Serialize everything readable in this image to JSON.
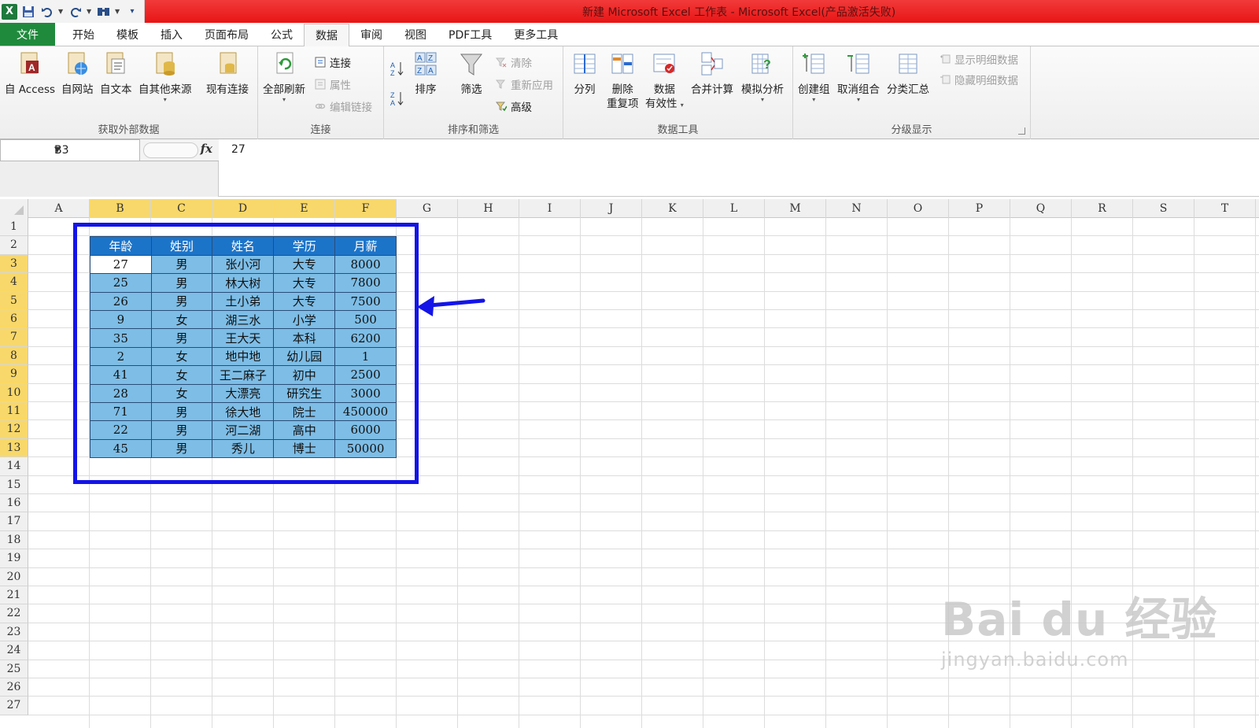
{
  "window": {
    "title": "新建 Microsoft Excel 工作表 - Microsoft Excel(产品激活失败)",
    "app_icon": "X"
  },
  "quick_access": {
    "icons": [
      "save-icon",
      "undo-icon",
      "redo-icon",
      "find-icon",
      "customize-icon"
    ]
  },
  "tabs": [
    "文件",
    "开始",
    "模板",
    "插入",
    "页面布局",
    "公式",
    "数据",
    "审阅",
    "视图",
    "PDF工具",
    "更多工具"
  ],
  "active_tab": "数据",
  "ribbon": {
    "get_external": {
      "label": "获取外部数据",
      "buttons": [
        "自 Access",
        "自网站",
        "自文本",
        "自其他来源",
        "现有连接"
      ]
    },
    "connections": {
      "label": "连接",
      "refresh_all": "全部刷新",
      "connect": "连接",
      "properties": "属性",
      "edit_links": "编辑链接"
    },
    "sort_filter": {
      "label": "排序和筛选",
      "sort": "排序",
      "filter": "筛选",
      "clear": "清除",
      "reapply": "重新应用",
      "advanced": "高级"
    },
    "data_tools": {
      "label": "数据工具",
      "split": "分列",
      "remove_dup_1": "删除",
      "remove_dup_2": "重复项",
      "validation_1": "数据",
      "validation_2": "有效性",
      "consolidate": "合并计算",
      "what_if": "模拟分析"
    },
    "outline": {
      "label": "分级显示",
      "group": "创建组",
      "ungroup": "取消组合",
      "subtotal": "分类汇总",
      "show_detail": "显示明细数据",
      "hide_detail": "隐藏明细数据"
    }
  },
  "formula_bar": {
    "name_box": "B3",
    "fx": "fx",
    "value": "27"
  },
  "columns": [
    "A",
    "B",
    "C",
    "D",
    "E",
    "F",
    "G",
    "H",
    "I",
    "J",
    "K",
    "L",
    "M",
    "N",
    "O",
    "P",
    "Q",
    "R",
    "S",
    "T"
  ],
  "rows": [
    "1",
    "2",
    "3",
    "4",
    "5",
    "6",
    "7",
    "8",
    "9",
    "10",
    "11",
    "12",
    "13",
    "14",
    "15",
    "16",
    "17",
    "18",
    "19",
    "20",
    "21",
    "22",
    "23",
    "24",
    "25",
    "26",
    "27"
  ],
  "table": {
    "headers": [
      "年龄",
      "姓别",
      "姓名",
      "学历",
      "月薪"
    ],
    "rows": [
      [
        "27",
        "男",
        "张小河",
        "大专",
        "8000"
      ],
      [
        "25",
        "男",
        "林大树",
        "大专",
        "7800"
      ],
      [
        "26",
        "男",
        "土小弟",
        "大专",
        "7500"
      ],
      [
        "9",
        "女",
        "湖三水",
        "小学",
        "500"
      ],
      [
        "35",
        "男",
        "王大天",
        "本科",
        "6200"
      ],
      [
        "2",
        "女",
        "地中地",
        "幼儿园",
        "1"
      ],
      [
        "41",
        "女",
        "王二麻子",
        "初中",
        "2500"
      ],
      [
        "28",
        "女",
        "大漂亮",
        "研究生",
        "3000"
      ],
      [
        "71",
        "男",
        "徐大地",
        "院士",
        "450000"
      ],
      [
        "22",
        "男",
        "河二湖",
        "高中",
        "6000"
      ],
      [
        "45",
        "男",
        "秀儿",
        "博士",
        "50000"
      ]
    ]
  },
  "annotation": {
    "box_color": "#1414e8",
    "arrow_color": "#1414e8"
  },
  "watermark": {
    "main": "Bai du 经验",
    "sub": "jingyan.baidu.com"
  },
  "colors": {
    "title_bar": "#e81515",
    "file_tab": "#1f8a3c",
    "table_header": "#1c74c9",
    "table_cell": "#7dbde6",
    "selected_header": "#f8d86a"
  }
}
